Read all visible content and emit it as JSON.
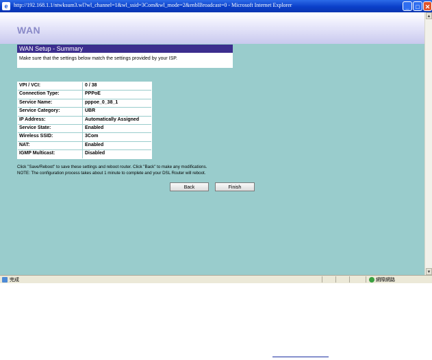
{
  "window": {
    "title": "http://192.168.1.1/ntwksum3.wl?wl_channel=1&wl_ssid=3Com&wl_mode=2&enblBroadcast=0 - Microsoft Internet Explorer",
    "app_icon": "e",
    "minimize": "_",
    "maximize": "□",
    "close": "✕"
  },
  "banner": {
    "title": "WAN"
  },
  "summary": {
    "header": "WAN Setup - Summary",
    "description": "Make sure that the settings below match the settings provided by your ISP."
  },
  "settings": [
    {
      "key": "VPI / VCI:",
      "value": "0 / 38"
    },
    {
      "key": "Connection Type:",
      "value": "PPPoE"
    },
    {
      "key": "Service Name:",
      "value": "pppoe_0_38_1"
    },
    {
      "key": "Service Category:",
      "value": "UBR"
    },
    {
      "key": "IP Address:",
      "value": "Automatically Assigned"
    },
    {
      "key": "Service State:",
      "value": "Enabled"
    },
    {
      "key": "Wireless SSID:",
      "value": "3Com"
    },
    {
      "key": "NAT:",
      "value": "Enabled"
    },
    {
      "key": "IGMP Multicast:",
      "value": "Disabled"
    }
  ],
  "notes": {
    "line1": "Click \"Save/Reboot\" to save these settings and reboot router. Click \"Back\" to make any modifications.",
    "line2": "NOTE: The configuration process takes about 1 minute to complete and your DSL Router will reboot."
  },
  "buttons": {
    "back": "Back",
    "finish": "Finish"
  },
  "statusbar": {
    "left_text": "完成",
    "zone_text": "網際網路"
  },
  "scrollbar": {
    "up": "▲",
    "down": "▼"
  }
}
